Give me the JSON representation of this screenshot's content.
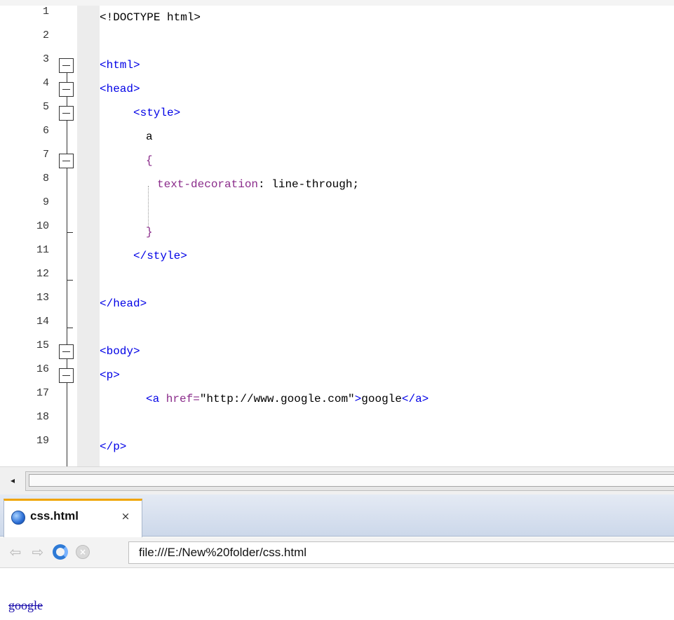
{
  "editor": {
    "lines": [
      {
        "num": "1",
        "code": "<!DOCTYPE html>"
      },
      {
        "num": "2",
        "code": ""
      },
      {
        "num": "3",
        "code": "<html>"
      },
      {
        "num": "4",
        "code": "<head>"
      },
      {
        "num": "5",
        "code": "   <style>"
      },
      {
        "num": "6",
        "code": "    a"
      },
      {
        "num": "7",
        "code": "    {"
      },
      {
        "num": "8",
        "code": "     text-decoration: line-through;"
      },
      {
        "num": "9",
        "code": ""
      },
      {
        "num": "10",
        "code": "    }"
      },
      {
        "num": "11",
        "code": "   </style>"
      },
      {
        "num": "12",
        "code": ""
      },
      {
        "num": "13",
        "code": "</head>"
      },
      {
        "num": "14",
        "code": ""
      },
      {
        "num": "15",
        "code": "<body>"
      },
      {
        "num": "16",
        "code": "<p>"
      },
      {
        "num": "17",
        "code": "    <a href=\"http://www.google.com\">google</a>"
      },
      {
        "num": "18",
        "code": ""
      },
      {
        "num": "19",
        "code": "</p>"
      }
    ],
    "code_parts": {
      "l1": "<!DOCTYPE html>",
      "l3": "<html>",
      "l4": "<head>",
      "l5": "<style>",
      "l6": "a",
      "l7": "{",
      "l8_prop": "text-decoration",
      "l8_colon": ":",
      "l8_value": " line-through;",
      "l10": "}",
      "l11": "</style>",
      "l13": "</head>",
      "l15": "<body>",
      "l16": "<p>",
      "l17_open": "<a",
      "l17_attr": " href=",
      "l17_val": "\"http://www.google.com\"",
      "l17_close": ">",
      "l17_text": "google",
      "l17_end": "</a>",
      "l19": "</p>"
    }
  },
  "scrollbar": {
    "left_arrow": "◂"
  },
  "browser": {
    "tab_label": "css.html",
    "tab_close": "×",
    "back_glyph": "⇦",
    "forward_glyph": "⇨",
    "stop_glyph": "×",
    "address": "file:///E:/New%20folder/css.html",
    "page_link": "google"
  },
  "colors": {
    "tag": "#0000e6",
    "property": "#8a2b8a",
    "tab_accent": "#f0a400",
    "link": "#1a0dab"
  }
}
